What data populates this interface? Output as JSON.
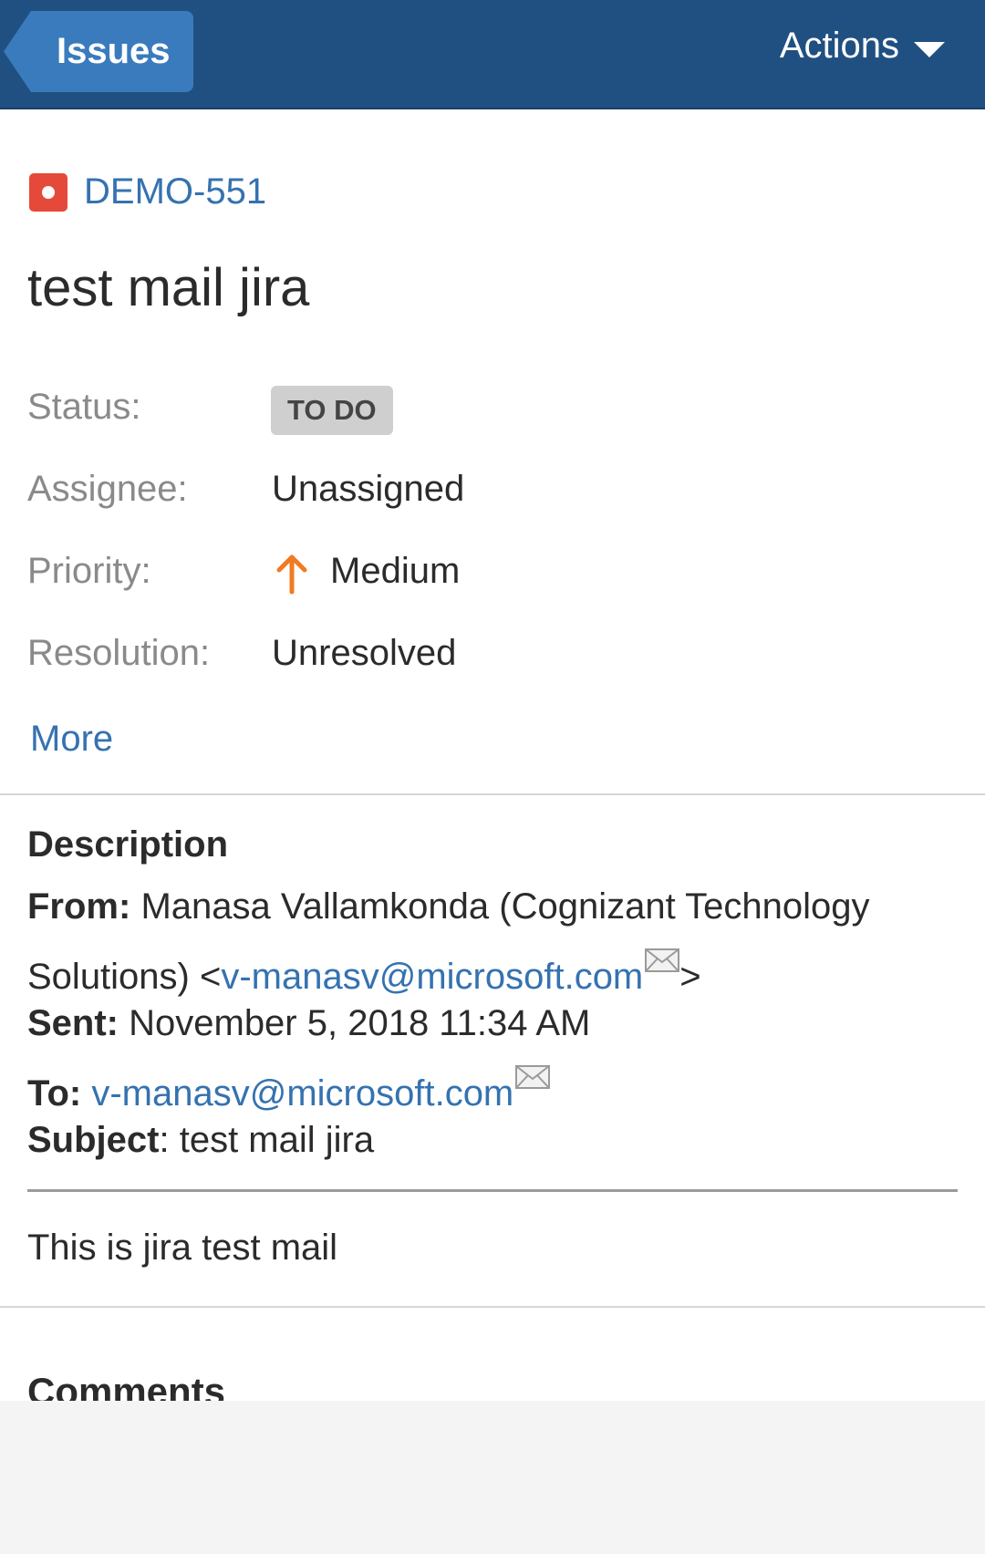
{
  "header": {
    "back_label": "Issues",
    "actions_label": "Actions",
    "bar_color": "#205081"
  },
  "issue": {
    "key": "DEMO-551",
    "type_icon": "bug-icon",
    "title": "test mail jira"
  },
  "fields": {
    "status_label": "Status:",
    "status_value": "TO DO",
    "assignee_label": "Assignee:",
    "assignee_value": "Unassigned",
    "priority_label": "Priority:",
    "priority_value": "Medium",
    "priority_icon": "arrow-up-icon",
    "priority_color": "#f07b22",
    "resolution_label": "Resolution:",
    "resolution_value": "Unresolved"
  },
  "more_label": "More",
  "description": {
    "heading": "Description",
    "from_label": "From:",
    "from_name": " Manasa Vallamkonda (Cognizant Technology",
    "from_name_cont": "Solutions) <",
    "from_email": "v-manasv@microsoft.com",
    "from_close": ">",
    "sent_label": "Sent:",
    "sent_value": " November 5, 2018 11:34 AM",
    "to_label": "To:",
    "to_email": "v-manasv@microsoft.com",
    "subject_label": "Subject",
    "subject_value": ": test mail jira",
    "body": "This is jira test mail"
  },
  "comments_heading": "Comments"
}
